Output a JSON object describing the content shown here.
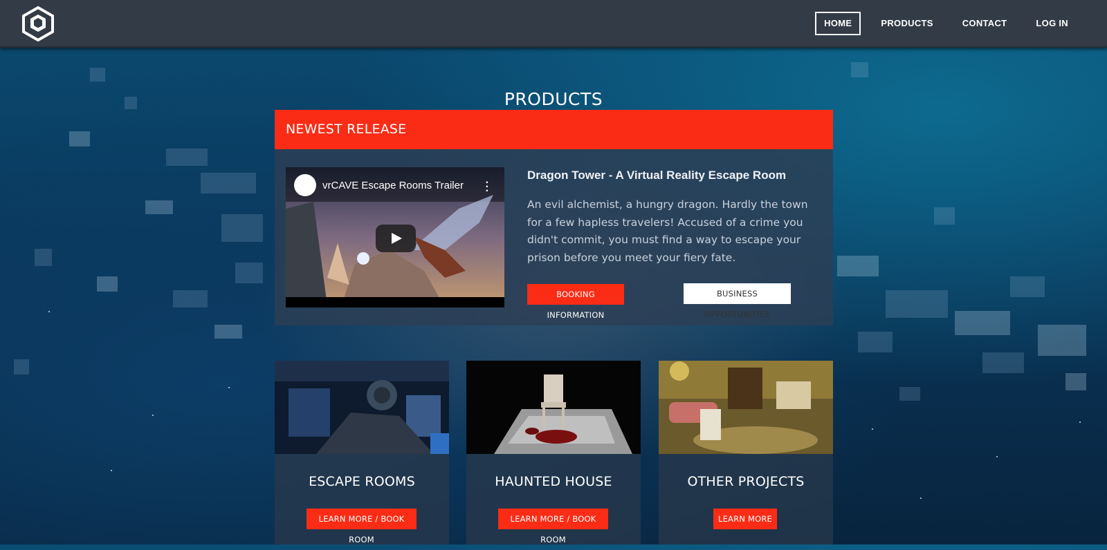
{
  "nav": {
    "logo_alt": "vrCAVE logo",
    "items": [
      {
        "label": "HOME",
        "active": true
      },
      {
        "label": "PRODUCTS",
        "active": false
      },
      {
        "label": "CONTACT",
        "active": false
      },
      {
        "label": "LOG IN",
        "active": false
      }
    ]
  },
  "page": {
    "title": "PRODUCTS"
  },
  "release": {
    "header": "NEWEST RELEASE",
    "video": {
      "title": "vrCAVE Escape Rooms Trailer"
    },
    "title": "Dragon Tower - A Virtual Reality Escape Room",
    "description": "An evil alchemist, a hungry dragon. Hardly the town for a few hapless travelers! Accused of a crime you didn't commit, you must find a way to escape your prison before you meet your fiery fate.",
    "booking_label": "BOOKING INFORMATION",
    "business_label": "BUSINESS OPPORTUNITIES"
  },
  "cards": [
    {
      "name": "ESCAPE ROOMS",
      "button": "LEARN MORE / BOOK ROOM"
    },
    {
      "name": "HAUNTED HOUSE",
      "button": "LEARN MORE / BOOK ROOM"
    },
    {
      "name": "OTHER PROJECTS",
      "button": "LEARN MORE"
    }
  ],
  "colors": {
    "accent": "#fa2c16",
    "nav_bg": "#333b47",
    "panel_bg": "#2d3e54"
  }
}
